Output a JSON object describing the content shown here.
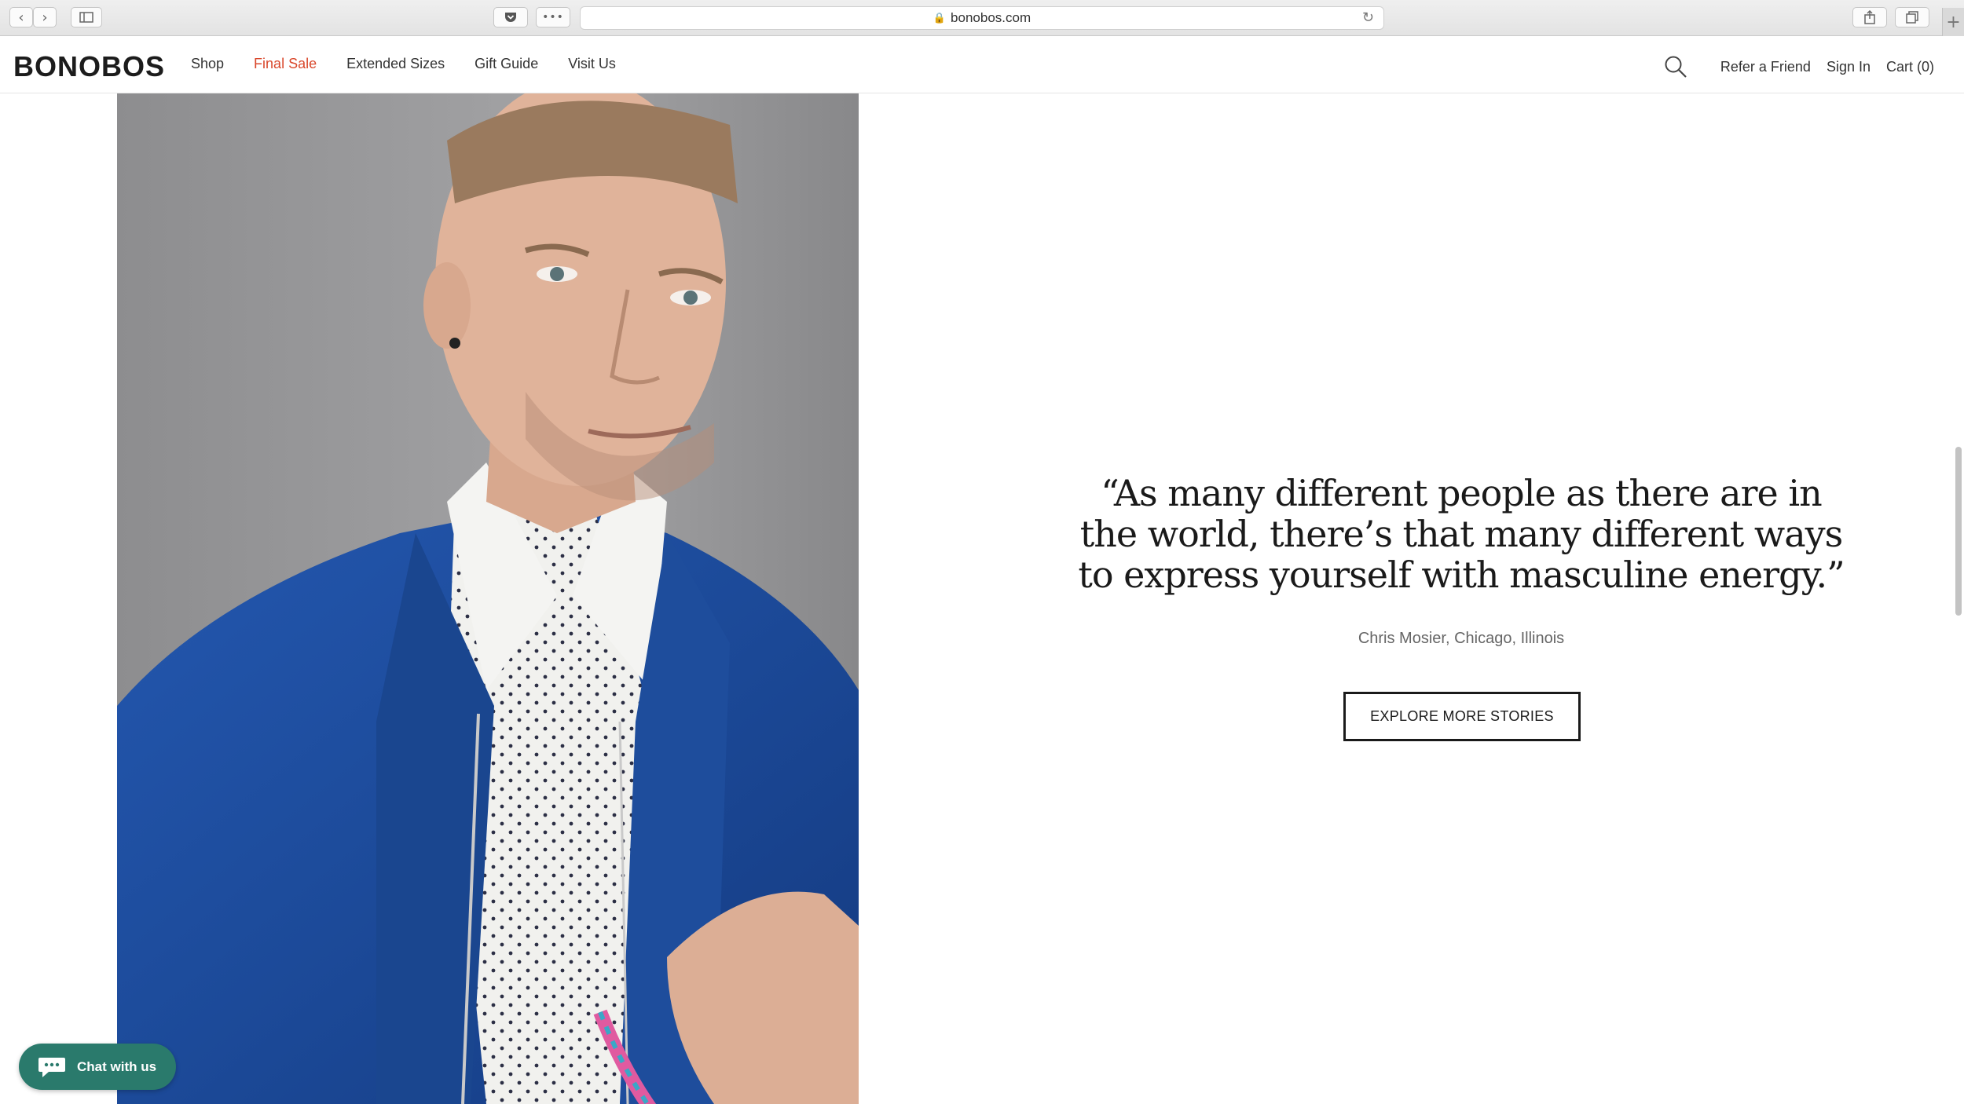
{
  "browser": {
    "url": "bonobos.com",
    "back_icon": "chevron-left-icon",
    "forward_icon": "chevron-right-icon",
    "sidebar_icon": "sidebar-icon",
    "pocket_icon": "pocket-icon",
    "more_icon": "ellipsis-icon",
    "reload_icon": "reload-icon",
    "share_icon": "share-icon",
    "tabs_icon": "tabs-icon",
    "new_tab_icon": "plus-icon"
  },
  "header": {
    "logo": "BONOBOS",
    "nav": [
      {
        "label": "Shop"
      },
      {
        "label": "Final Sale"
      },
      {
        "label": "Extended Sizes"
      },
      {
        "label": "Gift Guide"
      },
      {
        "label": "Visit Us"
      }
    ],
    "right": {
      "search_icon": "search-icon",
      "refer": "Refer a Friend",
      "sign_in": "Sign In",
      "cart": "Cart (0)"
    }
  },
  "story": {
    "quote": "“As many different people as there are in the world, there’s that many different ways to express yourself with masculine energy.”",
    "attribution": "Chris Mosier, Chicago, Illinois",
    "cta": "EXPLORE MORE STORIES"
  },
  "chat": {
    "label": "Chat with us"
  },
  "colors": {
    "sale": "#d9472b",
    "chat_bg": "#2a7a6c",
    "jacket": "#1f4f9e"
  }
}
